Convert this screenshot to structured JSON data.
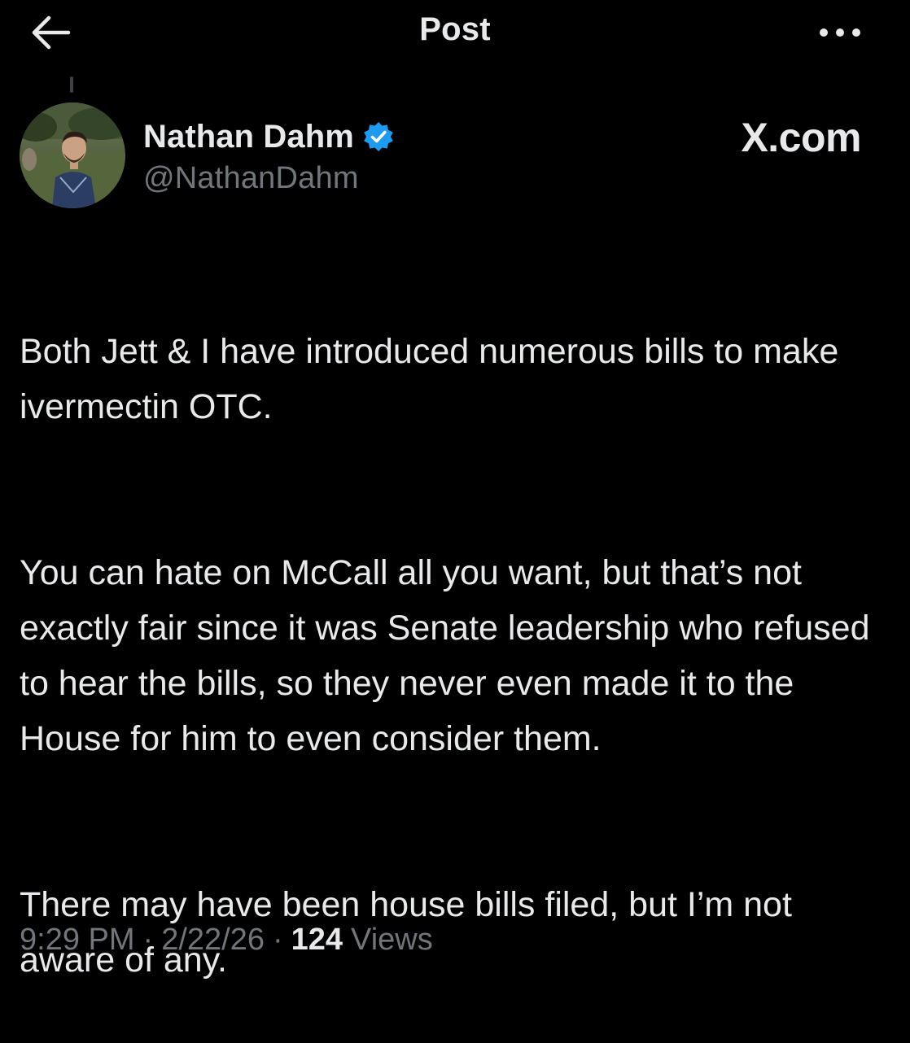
{
  "header": {
    "title": "Post",
    "back_icon": "arrow-left-icon",
    "more_icon": "more-horizontal-icon"
  },
  "author": {
    "name": "Nathan Dahm",
    "handle": "@NathanDahm",
    "verified": true,
    "verified_color": "#1d9bf0"
  },
  "watermark": "X.com",
  "post": {
    "paragraphs": [
      "Both Jett & I have introduced numerous bills to make ivermectin OTC.",
      "You can hate on McCall all you want, but that’s not exactly fair since it was Senate leadership who refused to hear the bills, so they never even made it to the House for him to even consider them.",
      "There may have been house bills filed, but I’m not aware of any."
    ],
    "time": "9:29 PM",
    "date": "2/22/26",
    "separator": "·",
    "views_count": "124",
    "views_label": "Views"
  },
  "colors": {
    "background": "#000000",
    "primary_text": "#e7e9ea",
    "secondary_text": "#71767b"
  }
}
